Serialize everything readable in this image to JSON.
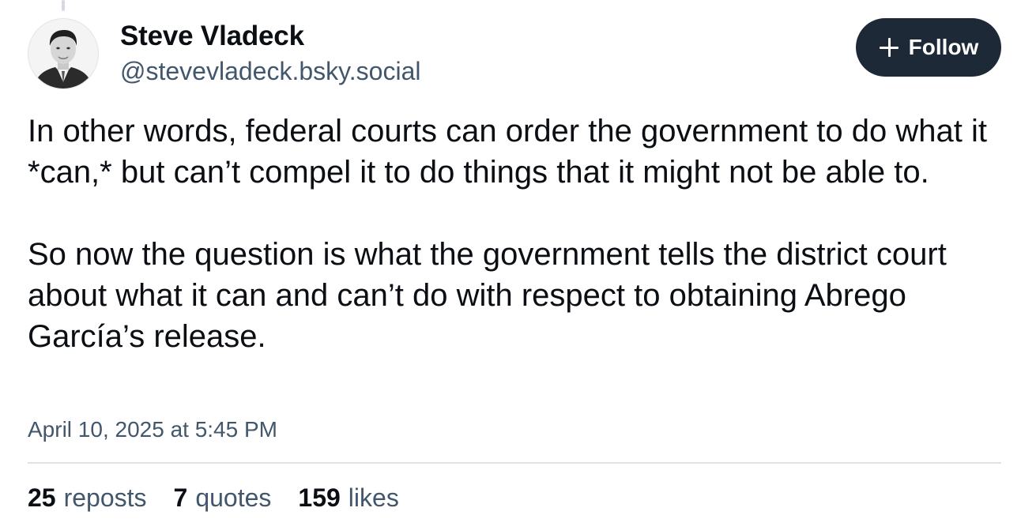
{
  "author": {
    "display_name": "Steve Vladeck",
    "handle": "@stevevladeck.bsky.social"
  },
  "follow_button": {
    "label": "Follow",
    "icon": "plus-icon"
  },
  "post": {
    "paragraphs": [
      "In other words, federal courts can order the government to do what it *can,* but can’t compel it to do things that it might not be able to.",
      "So now the question is what the government tells the district court about what it can and can’t do with respect to obtaining Abrego García’s release."
    ],
    "timestamp": "April 10, 2025 at 5:45 PM"
  },
  "stats": {
    "reposts": {
      "count": "25",
      "label": "reposts"
    },
    "quotes": {
      "count": "7",
      "label": "quotes"
    },
    "likes": {
      "count": "159",
      "label": "likes"
    }
  },
  "colors": {
    "follow_bg": "#1e2937",
    "secondary_text": "#42576c",
    "divider": "#dfe3e8"
  }
}
